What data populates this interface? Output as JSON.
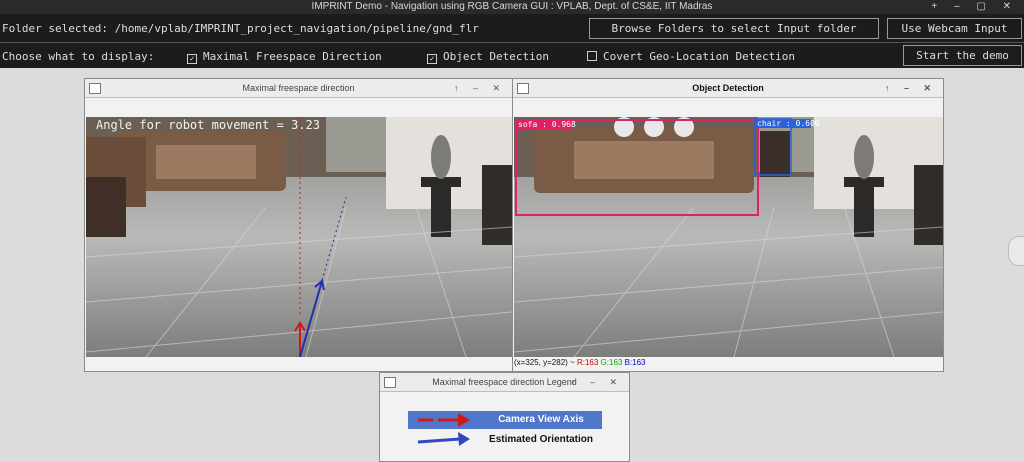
{
  "window": {
    "title": "IMPRINT Demo - Navigation using RGB Camera GUI : VPLAB, Dept. of CS&E, IIT Madras",
    "controls": "+ – ▢ ✕"
  },
  "toolbar": {
    "folder_label": "Folder selected: /home/vplab/IMPRINT_project_navigation/pipeline/gnd_flr",
    "browse_button": "Browse Folders to select Input folder",
    "webcam_button": "Use Webcam Input",
    "choose_label": "Choose what to display:",
    "options": [
      {
        "label": "Maximal Freespace Direction",
        "checked": true
      },
      {
        "label": "Object Detection",
        "checked": true
      },
      {
        "label": "Covert Geo-Location Detection",
        "checked": false
      }
    ],
    "start_button": "Start the demo"
  },
  "freespace_window": {
    "title": "Maximal freespace direction",
    "buttons": "↑ – ✕",
    "angle_text": "Angle for robot movement = 3.23"
  },
  "detection_window": {
    "title": "Object Detection",
    "buttons": "↑ – ✕",
    "detections": [
      {
        "label": "sofa : 0.968",
        "color": "#e0206a"
      },
      {
        "label": "chair : 0.600",
        "color": "#2b62d9"
      }
    ],
    "status": {
      "coords": "(x=325, y=282) ~",
      "r": "R:163",
      "g": "G:163",
      "b": "B:163"
    }
  },
  "legend_window": {
    "title": "Maximal freespace direction Legend",
    "buttons": "↑ – ✕",
    "items": [
      {
        "label": "Camera View Axis",
        "arrow_color": "#d01818",
        "highlight": true
      },
      {
        "label": "Estimated Orientation",
        "arrow_color": "#3048c0",
        "highlight": false
      }
    ]
  },
  "colors": {
    "toolbar_bg": "#1c1c1c",
    "camera_axis": "#d01818",
    "estimated_orientation": "#2030b0",
    "legend_highlight": "#4f76c8"
  },
  "icons": [
    "app-icon",
    "maximize-icon",
    "minimize-icon",
    "close-icon",
    "checkbox-icon",
    "scroll-handle-icon"
  ]
}
